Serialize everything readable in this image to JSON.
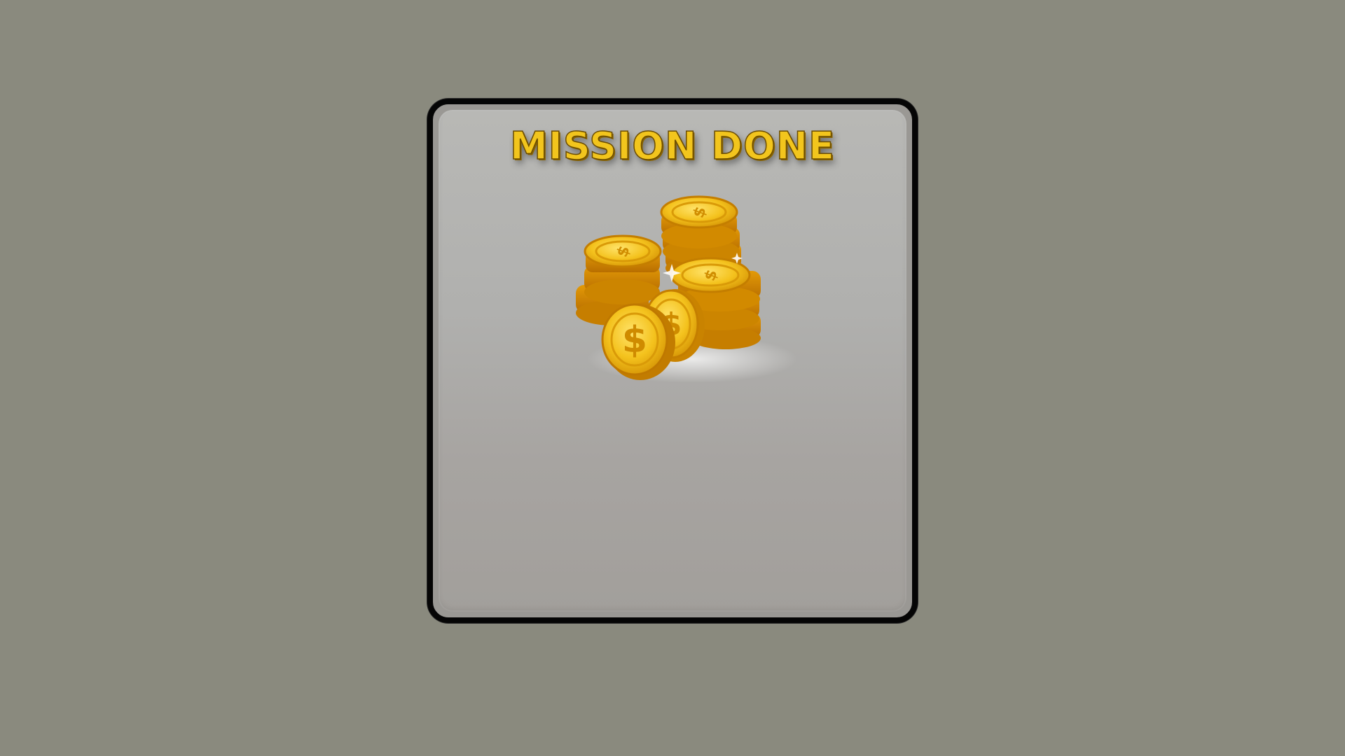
{
  "dialog": {
    "title": "MISSION DONE"
  },
  "reward": {
    "icon": "gold-coins-stack-icon",
    "coin_symbol": "$"
  },
  "colors": {
    "background": "#8a8a7e",
    "panel_border": "#050505",
    "panel_fill": "#b4b4b1",
    "title_gold": "#f2c51d",
    "coin_gold": "#f0b515"
  }
}
